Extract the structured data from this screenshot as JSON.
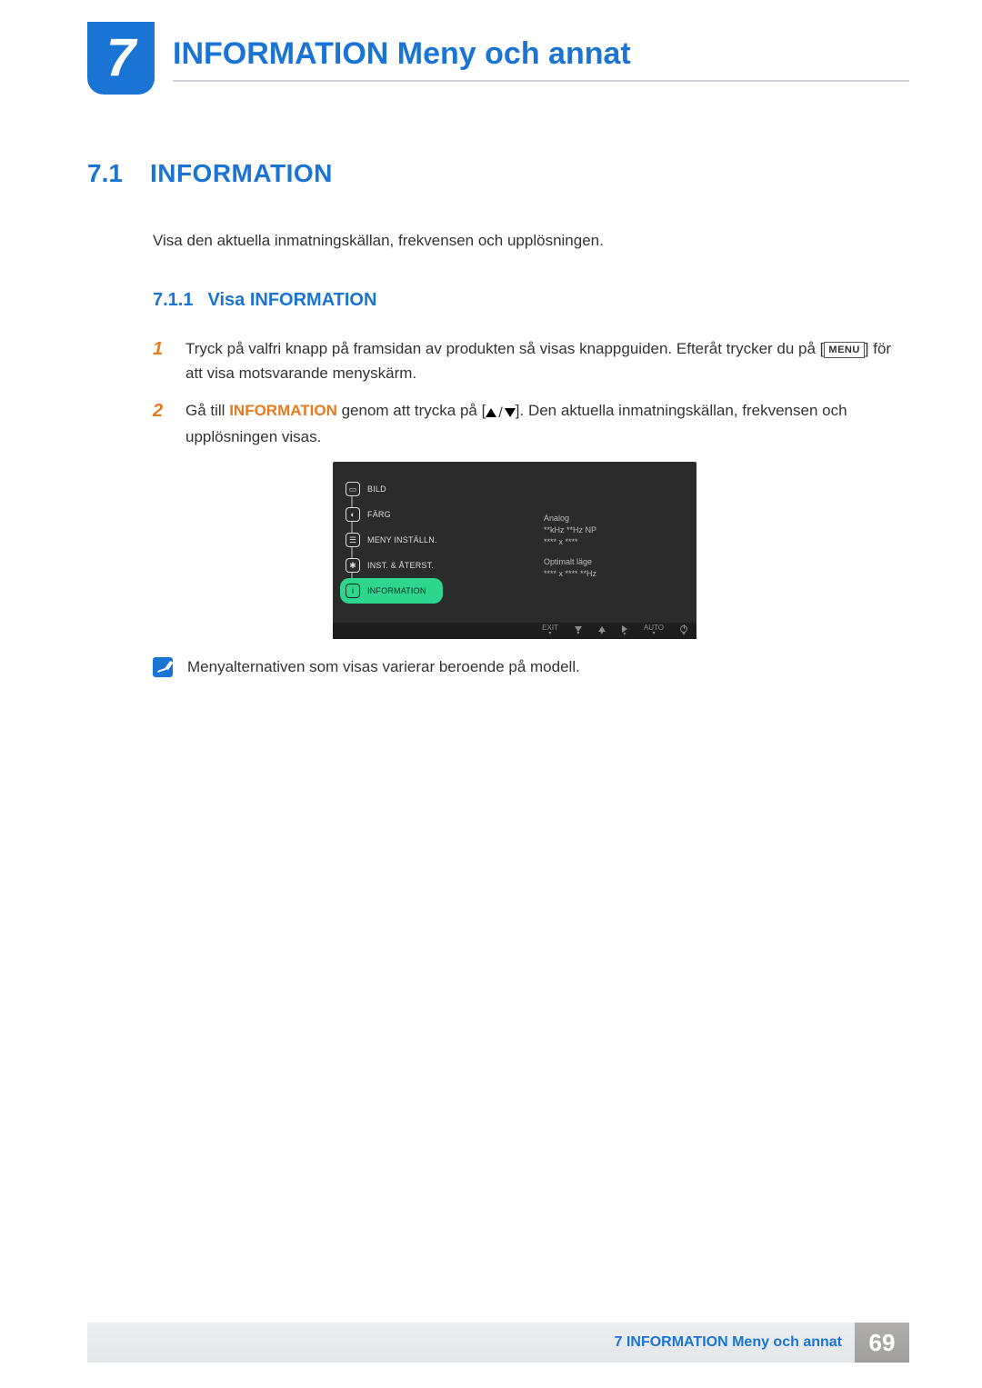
{
  "chapter": {
    "number": "7",
    "title": "INFORMATION Meny och annat"
  },
  "section": {
    "number": "7.1",
    "title": "INFORMATION",
    "intro": "Visa den aktuella inmatningskällan, frekvensen och upplösningen."
  },
  "subsection": {
    "number": "7.1.1",
    "title": "Visa INFORMATION"
  },
  "steps": {
    "s1": {
      "num": "1",
      "pre": "Tryck på valfri knapp på framsidan av produkten så visas knappguiden. Efteråt trycker du på [",
      "chip": "MENU",
      "post": "] för att visa motsvarande menyskärm."
    },
    "s2": {
      "num": "2",
      "pre": "Gå till ",
      "keyword": "INFORMATION",
      "mid": " genom att trycka på [",
      "post": "]. Den aktuella inmatningskällan, frekvensen och upplösningen visas."
    }
  },
  "osd": {
    "items": {
      "bild": "BILD",
      "farg": "FÄRG",
      "meny": "MENY INSTÄLLN.",
      "inst": "INST. & ÅTERST.",
      "info": "INFORMATION"
    },
    "right": {
      "signal": "Analog",
      "freq": "**kHz **Hz NP",
      "res": "**** x ****",
      "opt_label": "Optimalt läge",
      "opt_value": "**** x **** **Hz"
    },
    "bar": {
      "exit": "EXIT",
      "auto": "AUTO"
    }
  },
  "note": "Menyalternativen som visas varierar beroende på modell.",
  "footer": {
    "title": "7 INFORMATION Meny och annat",
    "page": "69"
  }
}
